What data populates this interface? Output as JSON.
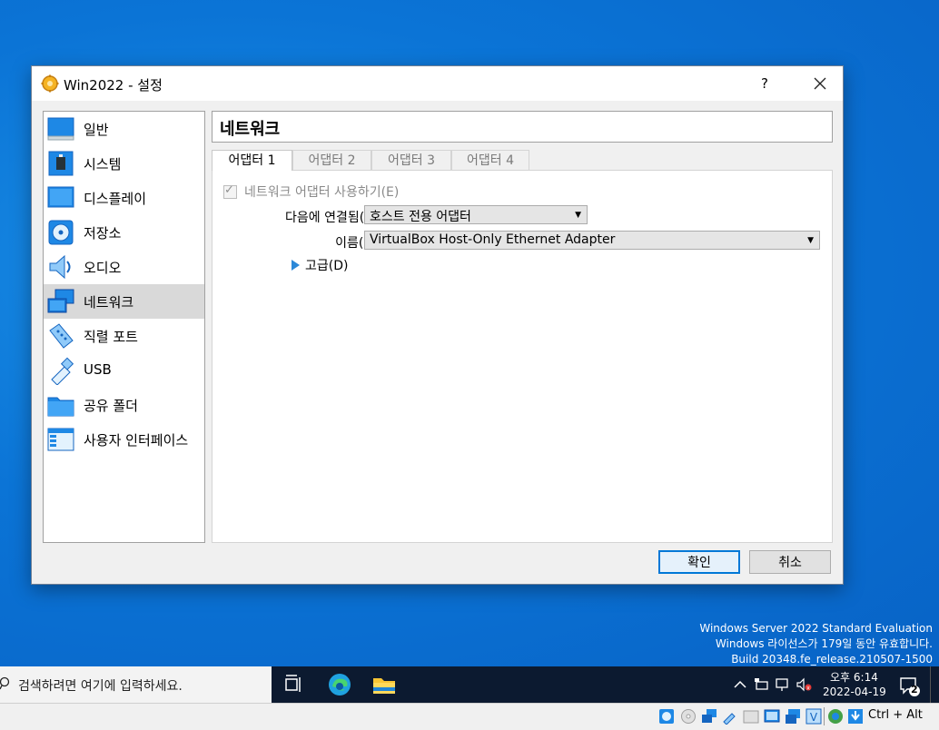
{
  "dialog": {
    "title": "Win2022 - 설정",
    "help_label": "?",
    "close_label": "✕"
  },
  "sidebar": {
    "items": [
      {
        "label": "일반",
        "icon": "general-icon"
      },
      {
        "label": "시스템",
        "icon": "system-icon"
      },
      {
        "label": "디스플레이",
        "icon": "display-icon"
      },
      {
        "label": "저장소",
        "icon": "storage-icon"
      },
      {
        "label": "오디오",
        "icon": "audio-icon"
      },
      {
        "label": "네트워크",
        "icon": "network-icon",
        "selected": true
      },
      {
        "label": "직렬 포트",
        "icon": "serial-port-icon"
      },
      {
        "label": "USB",
        "icon": "usb-icon"
      },
      {
        "label": "공유 폴더",
        "icon": "shared-folder-icon"
      },
      {
        "label": "사용자 인터페이스",
        "icon": "user-interface-icon"
      }
    ]
  },
  "page": {
    "header": "네트워크",
    "tabs": [
      {
        "label": "어댑터 1",
        "active": true
      },
      {
        "label": "어댑터 2"
      },
      {
        "label": "어댑터 3"
      },
      {
        "label": "어댑터 4"
      }
    ],
    "enable_adapter_label": "네트워크 어댑터 사용하기(E)",
    "attached_to_label": "다음에 연결됨(A):",
    "attached_to_value": "호스트 전용 어댑터",
    "name_label": "이름(N):",
    "name_value": "VirtualBox Host-Only Ethernet Adapter",
    "advanced_label": "고급(D)"
  },
  "buttons": {
    "ok_label": "확인",
    "cancel_label": "취소"
  },
  "watermark": {
    "line1": "Windows Server 2022 Standard Evaluation",
    "line2": "Windows 라이선스가 179일 동안 유효합니다.",
    "line3": "Build 20348.fe_release.210507-1500"
  },
  "taskbar": {
    "search_placeholder": "검색하려면 여기에 입력하세요.",
    "time": "오후 6:14",
    "date": "2022-04-19",
    "notification_count": "2"
  },
  "statusbar": {
    "host_key": "Ctrl + Alt"
  },
  "colors": {
    "desktop": "#0b74d6",
    "taskbar": "#0c1a30",
    "selected_item": "#d9d9d9",
    "accent": "#0078d7"
  }
}
